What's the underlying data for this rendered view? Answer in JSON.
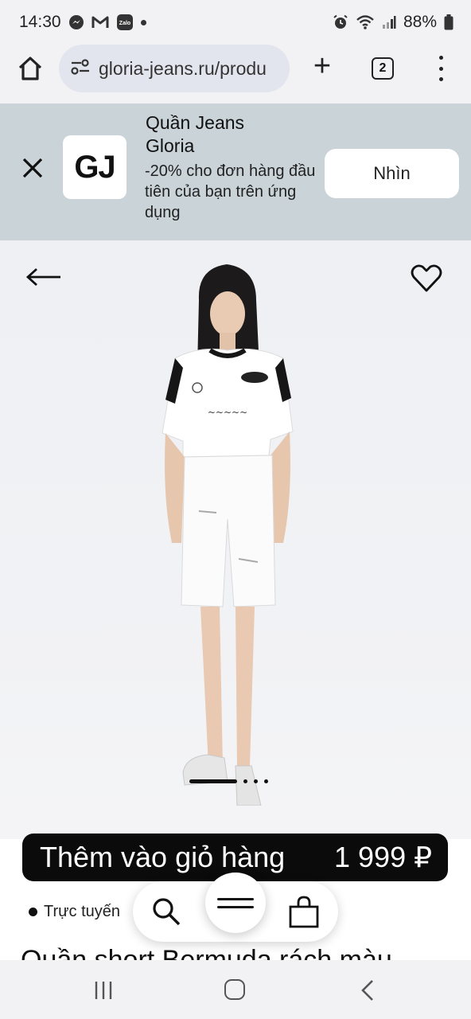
{
  "status_bar": {
    "time": "14:30",
    "notification_icons": [
      "messenger-icon",
      "gmail-icon",
      "zalo-icon"
    ],
    "zalo_label": "Zalo",
    "battery": "88%"
  },
  "browser": {
    "url": "gloria-jeans.ru/produ",
    "tab_count": "2",
    "new_tab_label": "+"
  },
  "app_banner": {
    "logo_text": "GJ",
    "title": "Quần Jeans Gloria",
    "description": "-20% cho đơn hàng đầu tiên của bạn trên ứng dụng",
    "view_button": "Nhìn"
  },
  "product": {
    "carousel": {
      "total_slides": 4,
      "active_index": 0
    },
    "add_to_cart_label": "Thêm vào giỏ hàng",
    "price": "1 999 ₽",
    "availability": "Trực tuyến",
    "title_partial": "Quần short Bermuda rách màu"
  },
  "colors": {
    "chrome_bg": "#f2f2f4",
    "banner_bg": "#c9d3d8",
    "cart_button": "#0b0b0b",
    "image_bg": "#eef0f3"
  }
}
